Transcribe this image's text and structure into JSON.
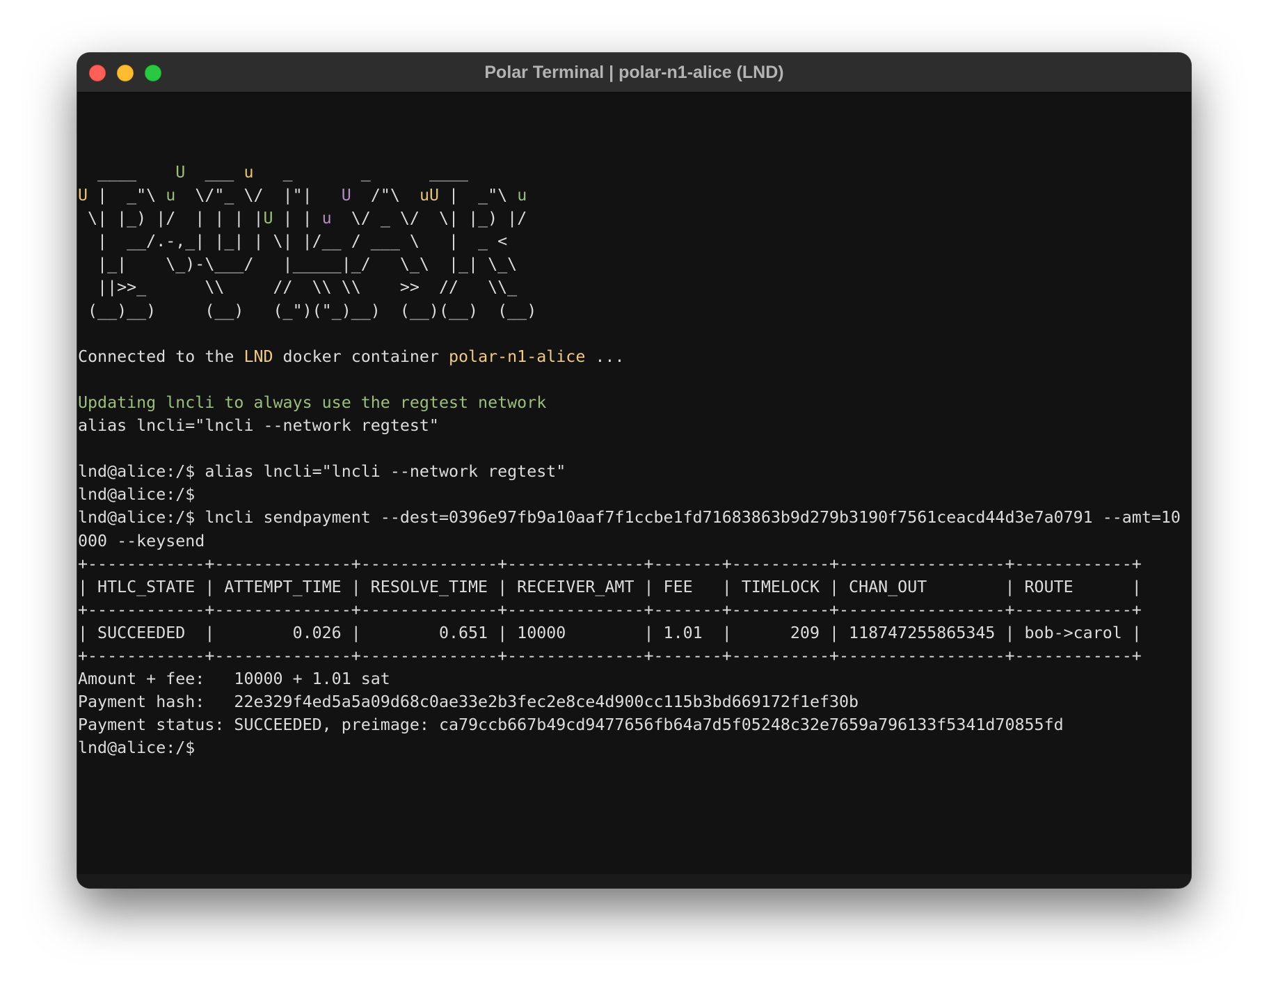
{
  "window": {
    "title": "Polar Terminal | polar-n1-alice (LND)"
  },
  "banner": {
    "l1": [
      "  ____    ",
      "U",
      "  ___ ",
      "u",
      "   _       _      ____"
    ],
    "l2": [
      "U",
      " |  _\"\\ ",
      "u",
      "  \\/\"_ \\/  |\"|   ",
      "U",
      "  /\"\\  ",
      "uU",
      " |  _\"\\ ",
      "u"
    ],
    "l3": [
      " \\| |_) |/  | | | |",
      "U",
      " | | ",
      "u",
      "  \\/ _ \\/  \\| |_) |/"
    ],
    "l4": "  |  __/.-,_| |_| | \\| |/__ / ___ \\   |  _ <",
    "l5": "  |_|    \\_)-\\___/   |_____|_/   \\_\\  |_| \\_\\",
    "l6": "  ||>>_      \\\\     //  \\\\ \\\\    >>  //   \\\\_",
    "l7": " (__)__)     (__)   (_\")(\"_)__)  (__)(__)  (__)"
  },
  "connected": {
    "prefix": "Connected to the ",
    "node_type": "LND",
    "middle": " docker container ",
    "container": "polar-n1-alice",
    "suffix": " ..."
  },
  "notice": "Updating lncli to always use the regtest network",
  "alias_line": "alias lncli=\"lncli --network regtest\"",
  "commands": {
    "c1": "lnd@alice:/$ alias lncli=\"lncli --network regtest\"",
    "c2": "lnd@alice:/$",
    "c3a": "lnd@alice:/$ lncli sendpayment --dest=0396e97fb9a10aaf7f1ccbe1fd71683863b9d279b3190f7561ceacd44d3e7a0791 --amt=10",
    "c3b": "000 --keysend"
  },
  "htlc_table": {
    "border": "+------------+--------------+--------------+--------------+-------+----------+-----------------+------------+",
    "header": "| HTLC_STATE | ATTEMPT_TIME | RESOLVE_TIME | RECEIVER_AMT | FEE   | TIMELOCK | CHAN_OUT        | ROUTE      |",
    "row": "| SUCCEEDED  |        0.026 |        0.651 | 10000        | 1.01  |      209 | 118747255865345 | bob->carol |"
  },
  "result": {
    "amount_line": "Amount + fee:   10000 + 1.01 sat",
    "hash_line": "Payment hash:   22e329f4ed5a5a09d68c0ae33e2b3fec2e8ce4d900cc115b3bd669172f1ef30b",
    "status_line": "Payment status: SUCCEEDED, preimage: ca79ccb667b49cd9477656fb64a7d5f05248c32e7659a796133f5341d70855fd"
  },
  "prompt": "lnd@alice:/$",
  "colors": {
    "banner_yellow": "#e8c469",
    "banner_green": "#9bbf7b",
    "banner_purple": "#b58cc1",
    "highlight_orange": "#f2c97d",
    "notice_green": "#9bbf7b"
  }
}
